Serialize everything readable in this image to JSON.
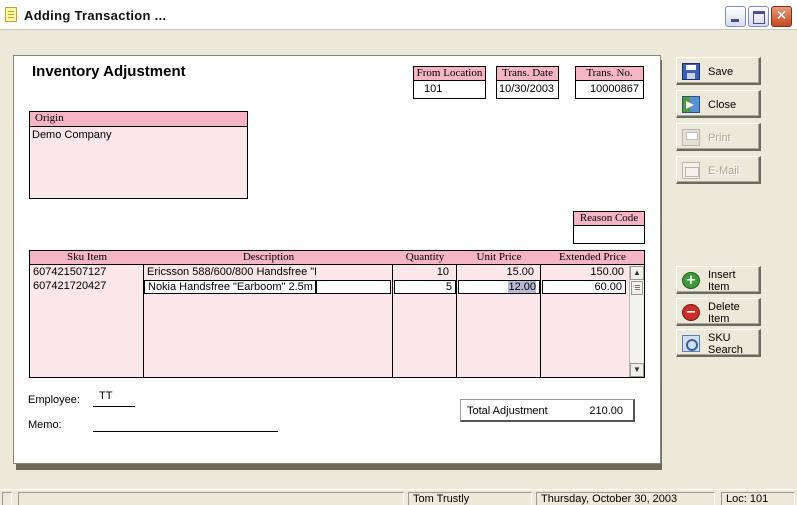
{
  "window": {
    "title": "Adding Transaction ..."
  },
  "form": {
    "title": "Inventory Adjustment",
    "from_location": {
      "label": "From Location",
      "value": "101"
    },
    "trans_date": {
      "label": "Trans. Date",
      "value": "10/30/2003"
    },
    "trans_no": {
      "label": "Trans. No.",
      "value": "10000867"
    },
    "origin": {
      "label": "Origin",
      "value": "Demo Company"
    },
    "reason_code": {
      "label": "Reason Code",
      "value": ""
    }
  },
  "grid": {
    "columns": [
      "Sku Item",
      "Description",
      "Quantity",
      "Unit Price",
      "Extended Price"
    ],
    "rows": [
      {
        "sku": "607421507127",
        "description": "Ericsson 588/600/800 Handsfree \"E",
        "quantity": "10",
        "unit_price": "15.00",
        "extended_price": "150.00"
      },
      {
        "sku": "607421720427",
        "description": "Nokia Handsfree \"Earboom\" 2.5m",
        "quantity": "5",
        "unit_price": "12.00",
        "extended_price": "60.00"
      }
    ]
  },
  "footer": {
    "employee_label": "Employee:",
    "employee_value": "TT",
    "memo_label": "Memo:",
    "memo_value": "",
    "total_label": "Total Adjustment",
    "total_value": "210.00"
  },
  "buttons": {
    "save": "Save",
    "close": "Close",
    "print": "Print",
    "email": "E-Mail",
    "insert_line1": "Insert",
    "insert_line2": "Item",
    "delete_line1": "Delete",
    "delete_line2": "Item",
    "sku_line1": "SKU",
    "sku_line2": "Search"
  },
  "status": {
    "user": "Tom Trustly",
    "date": "Thursday, October 30, 2003",
    "location": "Loc:  101"
  },
  "colors": {
    "label_fill": "#f5b5c2",
    "box_fill": "#fbe6ea",
    "window_bg": "#ece9d8"
  },
  "icons": [
    "app-icon",
    "minimize-icon",
    "maximize-icon",
    "close-window-icon",
    "save-icon",
    "close-icon",
    "print-icon",
    "email-icon",
    "insert-icon",
    "delete-icon",
    "search-icon"
  ]
}
